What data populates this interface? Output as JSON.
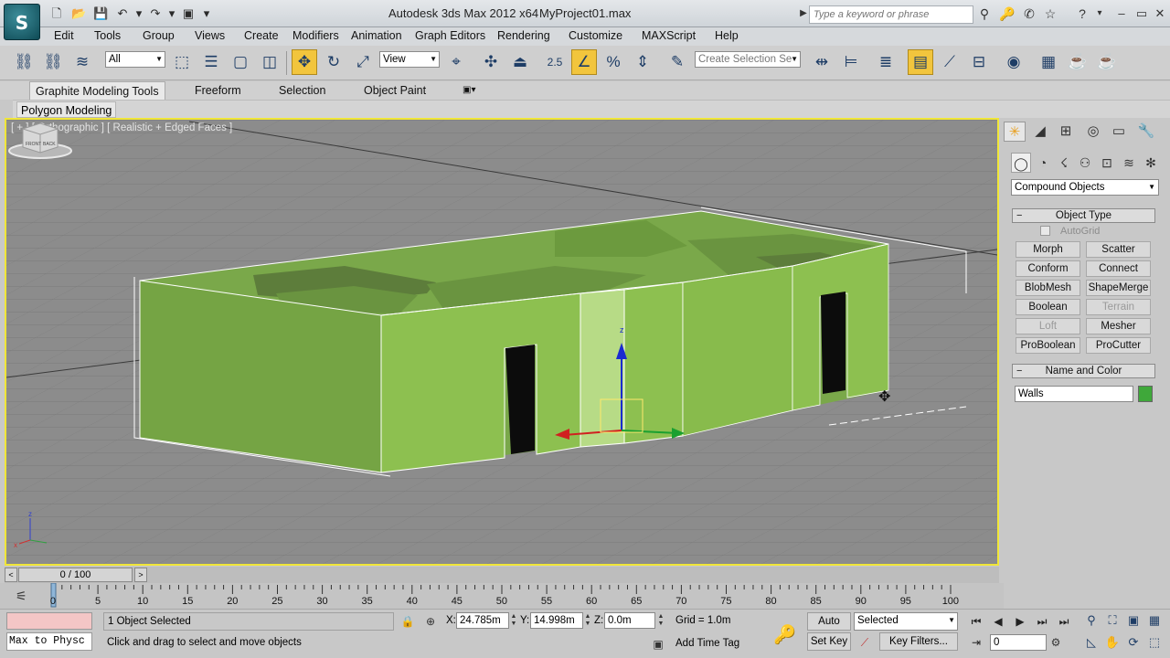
{
  "window": {
    "app_title": "Autodesk 3ds Max 2012 x64",
    "file_title": "MyProject01.max",
    "logo": "S",
    "search_placeholder": "Type a keyword or phrase"
  },
  "menu": [
    "Edit",
    "Tools",
    "Group",
    "Views",
    "Create",
    "Modifiers",
    "Animation",
    "Graph Editors",
    "Rendering",
    "Customize",
    "MAXScript",
    "Help"
  ],
  "toolbar": {
    "selection_filter": "All",
    "reference_coord": "View",
    "snap_angle_label": "2.5",
    "snap_percent_label": "%",
    "named_selection_placeholder": "Create Selection Se"
  },
  "ribbon": {
    "tabs": [
      "Graphite Modeling Tools",
      "Freeform",
      "Selection",
      "Object Paint"
    ],
    "active_tab": "Graphite Modeling Tools",
    "panel": "Polygon Modeling"
  },
  "viewport": {
    "label": "[ + ] [ Orthographic ] [ Realistic + Edged Faces ]",
    "gizmo_axis_z": "z",
    "world_axis_z": "z",
    "world_axis_x": "x",
    "viewcube_front": "FRONT",
    "viewcube_back": "BACK",
    "colors": {
      "background": "#8c8c8c",
      "grid": "#7a7a7a",
      "walls": "#8cc04e",
      "walls_dark": "#6a9a34",
      "active_border": "#f0e638"
    }
  },
  "command_panel": {
    "category": "Compound Objects",
    "object_type_title": "Object Type",
    "autogrid_label": "AutoGrid",
    "buttons": [
      {
        "label": "Morph",
        "enabled": true
      },
      {
        "label": "Scatter",
        "enabled": true
      },
      {
        "label": "Conform",
        "enabled": true
      },
      {
        "label": "Connect",
        "enabled": true
      },
      {
        "label": "BlobMesh",
        "enabled": true
      },
      {
        "label": "ShapeMerge",
        "enabled": true
      },
      {
        "label": "Boolean",
        "enabled": true
      },
      {
        "label": "Terrain",
        "enabled": false
      },
      {
        "label": "Loft",
        "enabled": false
      },
      {
        "label": "Mesher",
        "enabled": true
      },
      {
        "label": "ProBoolean",
        "enabled": true
      },
      {
        "label": "ProCutter",
        "enabled": true
      }
    ],
    "name_color_title": "Name and Color",
    "object_name": "Walls",
    "object_color": "#3fa83a"
  },
  "timeline": {
    "frame_display": "0 / 100",
    "ticks": [
      "0",
      "5",
      "10",
      "15",
      "20",
      "25",
      "30",
      "35",
      "40",
      "45",
      "50",
      "55",
      "60",
      "65",
      "70",
      "75",
      "80",
      "85",
      "90",
      "95",
      "100"
    ]
  },
  "status": {
    "maxscript_listener": "Max to Physc",
    "selection": "1 Object Selected",
    "prompt": "Click and drag to select and move objects",
    "x_label": "X:",
    "x_value": "24.785m",
    "y_label": "Y:",
    "y_value": "14.998m",
    "z_label": "Z:",
    "z_value": "0.0m",
    "grid": "Grid = 1.0m",
    "add_time_tag": "Add Time Tag",
    "auto_key": "Auto Key",
    "set_key": "Set Key",
    "key_mode": "Selected",
    "key_filters": "Key Filters...",
    "current_frame": "0"
  }
}
